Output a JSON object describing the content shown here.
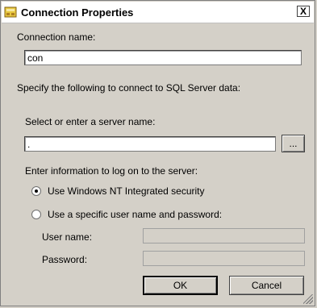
{
  "window": {
    "title": "Connection Properties",
    "close_label": "X"
  },
  "connection_name": {
    "label": "Connection name:",
    "value": "con"
  },
  "specify_text": "Specify the following to connect to SQL Server data:",
  "server": {
    "label": "Select or enter a server name:",
    "value": ".",
    "browse_label": "..."
  },
  "logon": {
    "label": "Enter information to log on to the server:",
    "options": [
      {
        "label": "Use Windows NT Integrated security",
        "selected": true
      },
      {
        "label": "Use a specific user name and password:",
        "selected": false
      }
    ],
    "username_label": "User name:",
    "username_value": "",
    "password_label": "Password:",
    "password_value": ""
  },
  "buttons": {
    "ok": "OK",
    "cancel": "Cancel"
  },
  "icons": {
    "app": "database-connection-icon",
    "close": "close-icon",
    "grip": "resize-grip-icon"
  }
}
